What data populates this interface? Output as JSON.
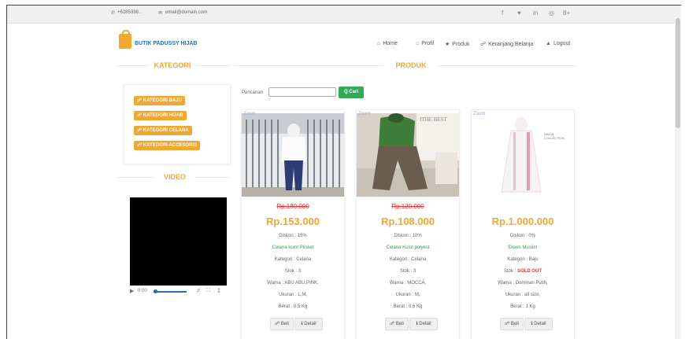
{
  "topbar": {
    "phone": "+6285398...",
    "email": "email@domain.com",
    "social": [
      "f",
      "♥",
      "in",
      "◎",
      "8+"
    ]
  },
  "brand": {
    "name": "BUTIK PADUSSY HIJAB"
  },
  "nav": [
    {
      "icon": "home-icon",
      "glyph": "⌂",
      "label": "Home"
    },
    {
      "icon": "profile-icon",
      "glyph": "⌂",
      "label": "Profil"
    },
    {
      "icon": "star-icon",
      "glyph": "★",
      "label": "Produk"
    },
    {
      "icon": "cart-icon",
      "glyph": "☷",
      "label": "Keranjang Belanja"
    },
    {
      "icon": "user-icon",
      "glyph": "▲",
      "label": "Logout"
    }
  ],
  "sidebar": {
    "kategori_title": "KATEGORI",
    "categories": [
      "KATEGORI BAJU",
      "KATEGORI HIJAB",
      "KATEGORI CELANA",
      "KATEGORI ACCESORIS"
    ],
    "video_title": "VIDEO",
    "video_time": "0:00"
  },
  "main": {
    "title": "PRODUK",
    "search_label": "Pencarian",
    "search_placeholder": "",
    "search_button": "Q Cari"
  },
  "products": [
    {
      "zoom": "Zoom",
      "old_price": "Rp.180.000",
      "price": "Rp.153.000",
      "diskon": "Diskon : 15%",
      "name": "Celana kulot Plisket",
      "kategori": "Kategori : Celana",
      "stok": "Stok : 3",
      "stok_value": "",
      "warna": "Warna : ABU ABU,PINK,",
      "ukuran": "Ukuran : L,M,",
      "berat": "Berat : 0.5 Kg",
      "beli": "Beli",
      "detail": "Detail"
    },
    {
      "zoom": "Zoom",
      "old_price": "Rp.120.000",
      "price": "Rp.108.000",
      "diskon": "Diskon : 10%",
      "name": "Celana Kulot polyest",
      "kategori": "Kategori : Celana",
      "stok": "Stok : 3",
      "stok_value": "",
      "warna": "Warna : MOCCA,",
      "ukuran": "Ukuran : M,",
      "berat": "Berat : 0.6 Kg",
      "beli": "Beli",
      "detail": "Detail"
    },
    {
      "zoom": "Zoom",
      "old_price": "",
      "price": "Rp.1.000.000",
      "diskon": "Diskon : 0%",
      "name": "Drees Muslim",
      "kategori": "Kategori : Baju",
      "stok": "Stok :",
      "stok_value": "SOLD OUT",
      "warna": "Warna : Dominan Putih,",
      "ukuran": "Ukuran : all size,",
      "berat": "Berat : 1 Kg",
      "beli": "Beli",
      "detail": "Detail"
    }
  ],
  "colors": {
    "accent": "#f0a830",
    "search_button": "#33aa55",
    "brand": "#2a6fb7",
    "strike": "#e33333"
  }
}
